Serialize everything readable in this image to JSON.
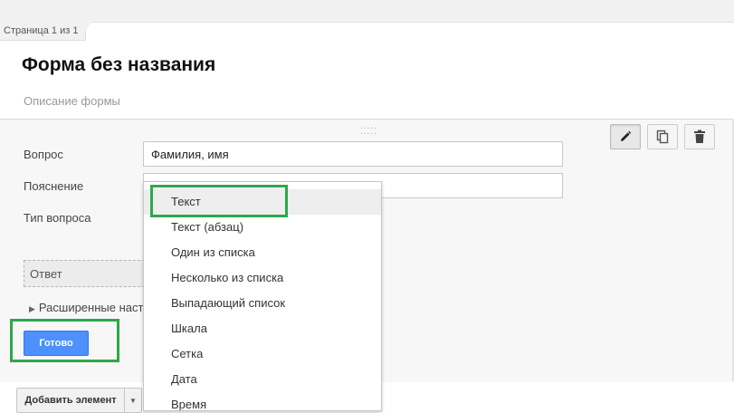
{
  "page_tab": "Страница 1 из 1",
  "form": {
    "title": "Форма без названия",
    "description_placeholder": "Описание формы"
  },
  "question": {
    "question_label": "Вопрос",
    "question_value": "Фамилия, имя",
    "hint_label": "Пояснение",
    "hint_value": "",
    "type_label": "Тип вопроса",
    "answer_label": "Ответ",
    "advanced_label": "Расширенные наст"
  },
  "toolbar": {
    "edit_icon": "pencil-icon",
    "duplicate_icon": "copy-icon",
    "delete_icon": "trash-icon"
  },
  "buttons": {
    "done": "Готово",
    "add_element": "Добавить элемент"
  },
  "question_types": [
    "Текст",
    "Текст (абзац)",
    "Один из списка",
    "Несколько из списка",
    "Выпадающий список",
    "Шкала",
    "Сетка",
    "Дата",
    "Время"
  ],
  "colors": {
    "highlight": "#2ea74a",
    "primary_button": "#4d90fe"
  }
}
